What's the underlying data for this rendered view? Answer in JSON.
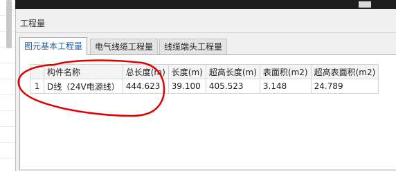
{
  "panel": {
    "title": "工程量"
  },
  "tabs": [
    {
      "label": "图元基本工程量",
      "active": true
    },
    {
      "label": "电气线缆工程量",
      "active": false
    },
    {
      "label": "线缆端头工程量",
      "active": false
    }
  ],
  "table": {
    "headers": [
      "",
      "构件名称",
      "总长度(m)",
      "长度(m)",
      "超高长度(m)",
      "表面积(m2)",
      "超高表面积(m2)"
    ],
    "rows": [
      [
        "1",
        "D线（24V电源线）",
        "444.623",
        "39.100",
        "405.523",
        "3.148",
        "24.789"
      ]
    ]
  },
  "annotation": {
    "color": "#e00000",
    "shape": "hand-drawn-ellipse"
  },
  "colors": {
    "active_tab_text": "#1f5fa8",
    "panel_bg": "#f0f0f0"
  }
}
